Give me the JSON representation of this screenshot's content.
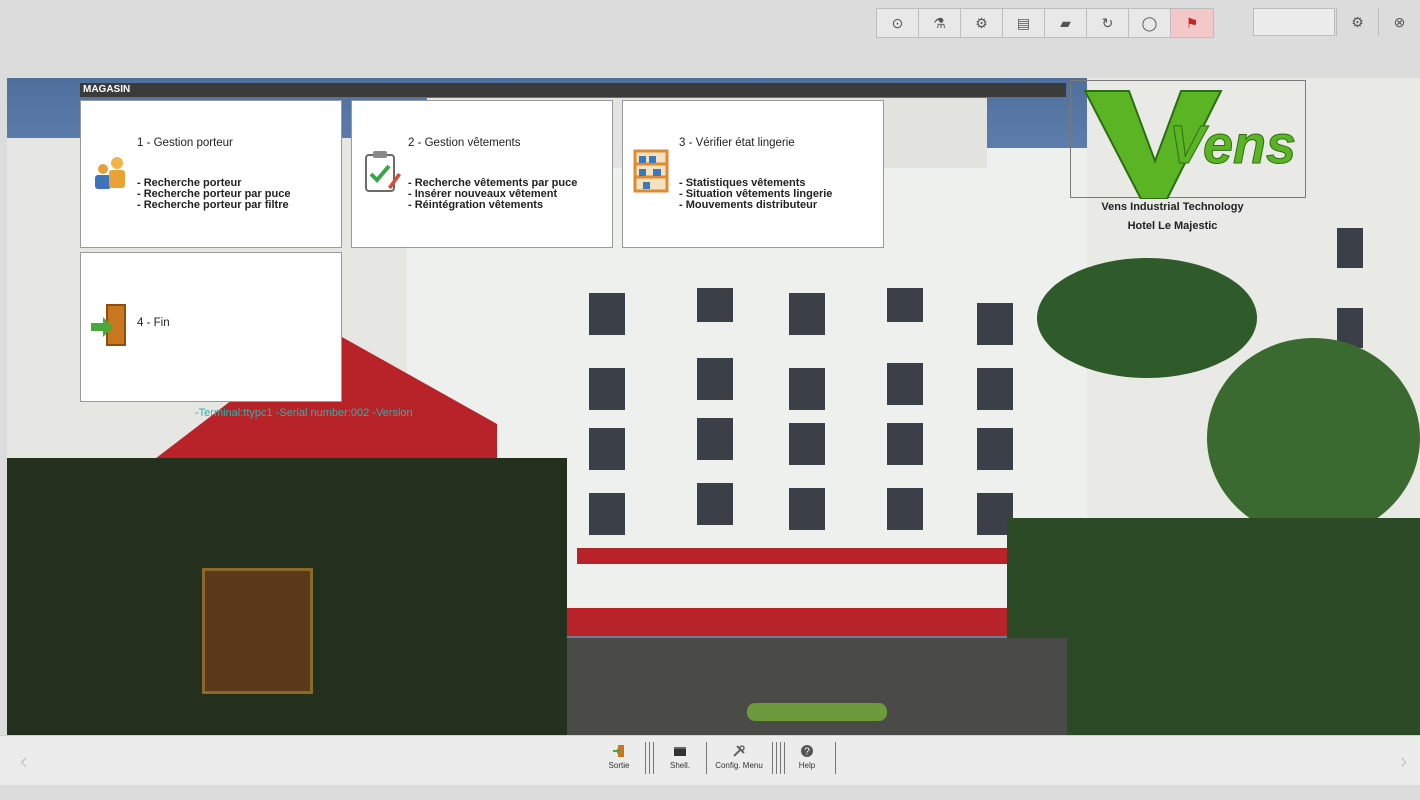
{
  "toolbar": {
    "buttons": [
      {
        "name": "eye-icon",
        "glyph": "⊙"
      },
      {
        "name": "flask-icon",
        "glyph": "⚗"
      },
      {
        "name": "satellite-icon",
        "glyph": "⚙"
      },
      {
        "name": "calculator-icon",
        "glyph": "▤"
      },
      {
        "name": "note-icon",
        "glyph": "▰"
      },
      {
        "name": "refresh-icon",
        "glyph": "↻"
      },
      {
        "name": "circle-arrow-icon",
        "glyph": "◯"
      },
      {
        "name": "flag-icon",
        "glyph": "⚑"
      }
    ],
    "right_buttons": [
      {
        "name": "settings-icon",
        "glyph": "⚙"
      },
      {
        "name": "power-icon",
        "glyph": "⊗"
      }
    ]
  },
  "menu": {
    "title": "MAGASIN",
    "cards": [
      {
        "title": "1 - Gestion porteur",
        "items": [
          "- Recherche porteur",
          "- Recherche porteur par puce",
          "- Recherche porteur par filtre"
        ],
        "icon": "people-icon"
      },
      {
        "title": "2 - Gestion vêtements",
        "items": [
          "- Recherche vêtements par puce",
          "- Insérer nouveaux vêtement",
          "- Réintégration vêtements"
        ],
        "icon": "clipboard-icon"
      },
      {
        "title": "3 - Vérifier état lingerie",
        "items": [
          "- Statistiques vêtements",
          "- Situation vêtements lingerie",
          "- Mouvements distributeur"
        ],
        "icon": "shelf-icon"
      },
      {
        "title": "4 - Fin",
        "items": [],
        "icon": "exit-door-icon"
      }
    ]
  },
  "status_text": "-Terminal:ttypc1 -Serial number:002 -Version",
  "logo": {
    "brand": "Vens",
    "line1": "Vens Industrial Technology",
    "line2": "Hotel Le Majestic"
  },
  "bottom": {
    "items": [
      {
        "label": "Sortie",
        "icon": "exit-icon"
      },
      {
        "label": "Shell.",
        "icon": "terminal-icon"
      },
      {
        "label": "Config. Menu",
        "icon": "tools-icon"
      },
      {
        "label": "Help",
        "icon": "help-icon"
      }
    ]
  },
  "colors": {
    "accent_green": "#5ab424",
    "flag_bg": "#f3c8c8"
  }
}
